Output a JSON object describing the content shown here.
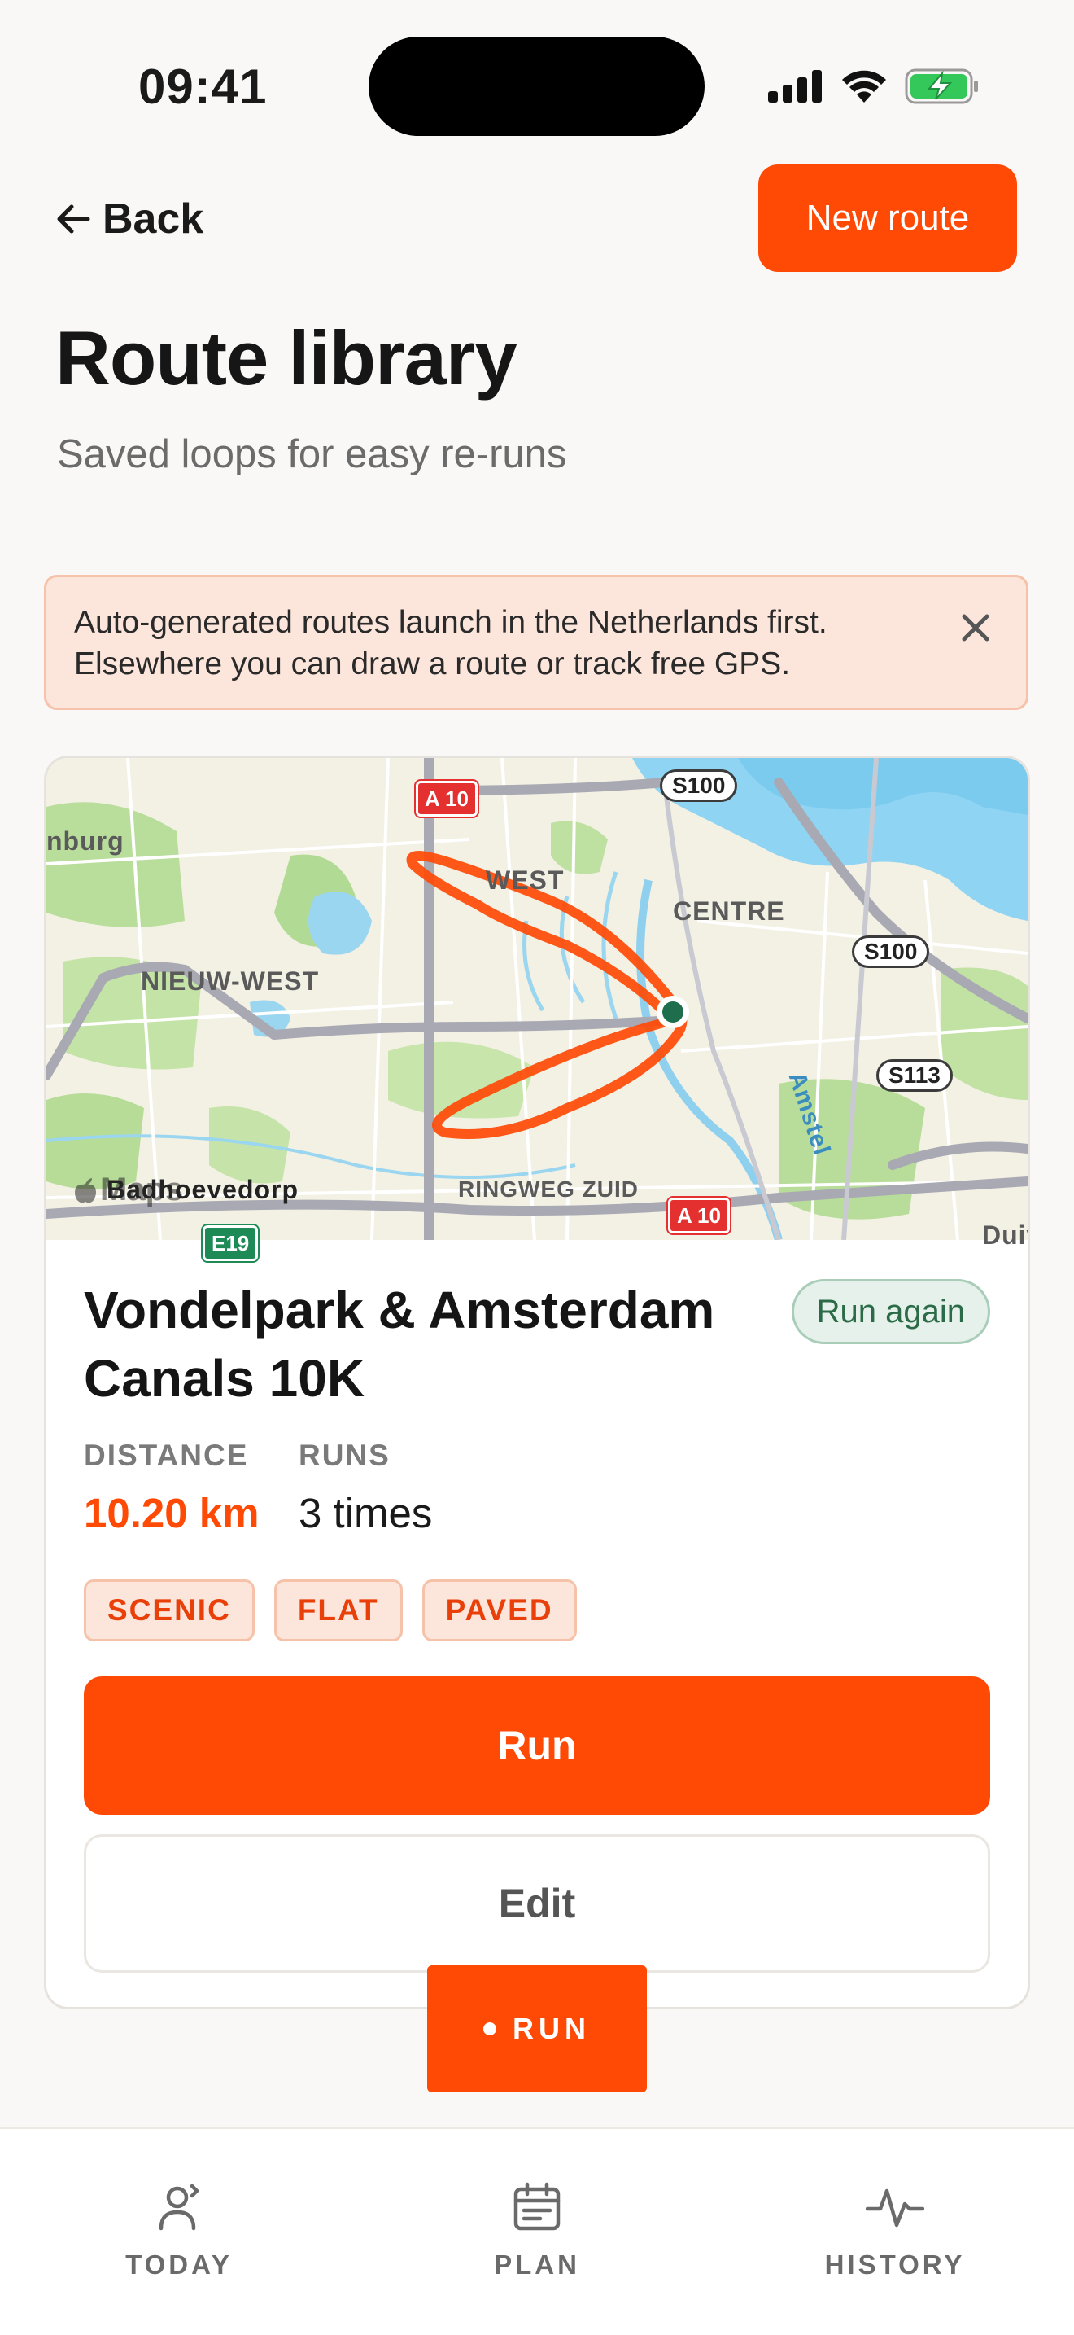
{
  "status_bar": {
    "time": "09:41"
  },
  "header": {
    "back_label": "Back",
    "new_route_label": "New route",
    "title": "Route library",
    "subtitle": "Saved loops for easy re-runs"
  },
  "banner": {
    "text": "Auto-generated routes launch in the Netherlands first. Elsewhere you can draw a route or track free GPS."
  },
  "route_card": {
    "map": {
      "place_labels": [
        "nburg",
        "WEST",
        "CENTRE",
        "NIEUW-WEST",
        "Badhoevedorp",
        "RINGWEG ZUID",
        "Amstel",
        "Duive"
      ],
      "road_shields": [
        "A 10",
        "S100",
        "S100",
        "S113",
        "A 10",
        "E19"
      ],
      "attribution": "Maps"
    },
    "title": "Vondelpark & Amsterdam Canals 10K",
    "badge": "Run again",
    "stats": {
      "distance_label": "DISTANCE",
      "distance_value": "10.20 km",
      "runs_label": "RUNS",
      "runs_value": "3 times"
    },
    "tags": [
      "SCENIC",
      "FLAT",
      "PAVED"
    ],
    "run_button": "Run",
    "edit_button": "Edit"
  },
  "floating_run": {
    "label": "RUN"
  },
  "tab_bar": {
    "items": [
      {
        "label": "TODAY",
        "icon": "person-icon"
      },
      {
        "label": "PLAN",
        "icon": "calendar-icon"
      },
      {
        "label": "HISTORY",
        "icon": "activity-icon"
      }
    ]
  },
  "colors": {
    "accent": "#FF4A05",
    "background": "#FAF8F6",
    "banner_bg": "#FCE6DC",
    "badge_green": "#2C6B47"
  }
}
